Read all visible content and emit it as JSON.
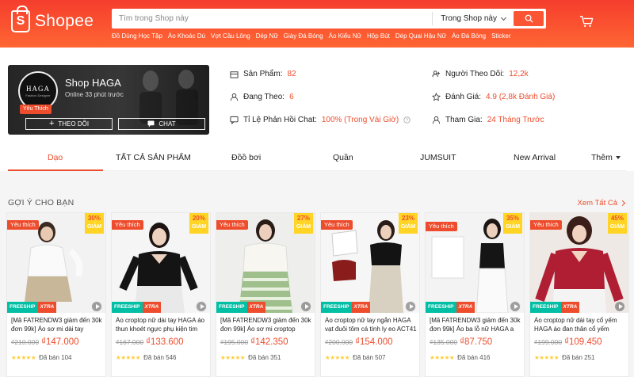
{
  "header": {
    "logo_text": "Shopee",
    "logo_glyph": "S",
    "search_placeholder": "Tìm trong Shop này",
    "search_scope": "Trong Shop này",
    "suggestions": [
      "Đồ Dùng Học Tập",
      "Áo Khoác Dù",
      "Vợt Cầu Lông",
      "Dép Nữ",
      "Giày Đá Bóng",
      "Áo Kiểu Nữ",
      "Hộp Bút",
      "Dép Quai Hậu Nữ",
      "Áo Đá Bóng",
      "Sticker"
    ]
  },
  "shop": {
    "avatar_text": "HAGA",
    "avatar_sub": "Fashion Designer",
    "badge": "Yêu Thích",
    "name": "Shop HAGA",
    "online": "Online 33 phút trước",
    "follow_label": "THEO DÕI",
    "chat_label": "CHAT",
    "stats": {
      "products_label": "Sản Phẩm:",
      "products_value": "82",
      "followers_label": "Người Theo Dõi:",
      "followers_value": "12,2k",
      "following_label": "Đang Theo:",
      "following_value": "6",
      "rating_label": "Đánh Giá:",
      "rating_value": "4.9 (2,8k Đánh Giá)",
      "chat_rate_label": "Tỉ Lệ Phản Hồi Chat:",
      "chat_rate_value": "100% (Trong Vài Giờ)",
      "joined_label": "Tham Gia:",
      "joined_value": "24 Tháng Trước"
    }
  },
  "tabs": [
    "Dạo",
    "TẤT CẢ SẢN PHẨM",
    "Đồồ bơi",
    "Quần",
    "JUMSUIT",
    "New Arrival",
    "Thêm"
  ],
  "active_tab": "Dạo",
  "suggestions_section": {
    "title": "GỢI Ý CHO BẠN",
    "see_all": "Xem Tất Cả"
  },
  "products": [
    {
      "fav": "Yêu thích",
      "discount": "30%",
      "discount_word": "GIẢM",
      "name": "[Mã FATRENDW3 giảm đến 30k đơn 99k] Áo sơ mi dài tay HAGA",
      "old_price": "₫210.000",
      "price": "₫147.000",
      "sold": "Đã bán 104"
    },
    {
      "fav": "Yêu thích",
      "discount": "20%",
      "discount_word": "GIẢM",
      "name": "Áo croptop nữ dài tay HAGA áo thun khoét ngực phụ kiện tim",
      "old_price": "₫167.000",
      "price": "₫133.600",
      "sold": "Đã bán 546"
    },
    {
      "fav": "Yêu thích",
      "discount": "27%",
      "discount_word": "GIẢM",
      "name": "[Mã FATRENDW3 giảm đến 30k đơn 99k] Áo sơ mi croptop HAGA",
      "old_price": "₫195.000",
      "price": "₫142.350",
      "sold": "Đã bán 351"
    },
    {
      "fav": "Yêu thích",
      "discount": "23%",
      "discount_word": "GIẢM",
      "name": "Áo croptop nữ tay ngắn HAGA vạt đuôi tôm cá tính ly eo ACT41",
      "old_price": "₫200.000",
      "price": "₫154.000",
      "sold": "Đã bán 507"
    },
    {
      "fav": "Yêu thích",
      "discount": "35%",
      "discount_word": "GIẢM",
      "name": "[Mã FATRENDW3 giảm đến 30k đơn 99k] Áo ba lỗ nữ HAGA a",
      "old_price": "₫135.000",
      "price": "₫87.750",
      "sold": "Đã bán 416"
    },
    {
      "fav": "Yêu thích",
      "discount": "45%",
      "discount_word": "GIẢM",
      "name": "Áo croptop nữ dài tay cổ yếm HAGA áo đan thân cổ yếm ADTCY65",
      "old_price": "₫199.000",
      "price": "₫109.450",
      "sold": "Đã bán 251"
    }
  ],
  "product_labels": {
    "freeship": "FREESHIP",
    "xtra": "XTRA",
    "stars": "★★★★★"
  },
  "colors": {
    "brand": "#ee4d2d",
    "header_start": "#f53d2d",
    "header_end": "#ff6633",
    "freeship": "#00bfa5",
    "discount_bg": "#ffd424",
    "star": "#ffce3d"
  }
}
